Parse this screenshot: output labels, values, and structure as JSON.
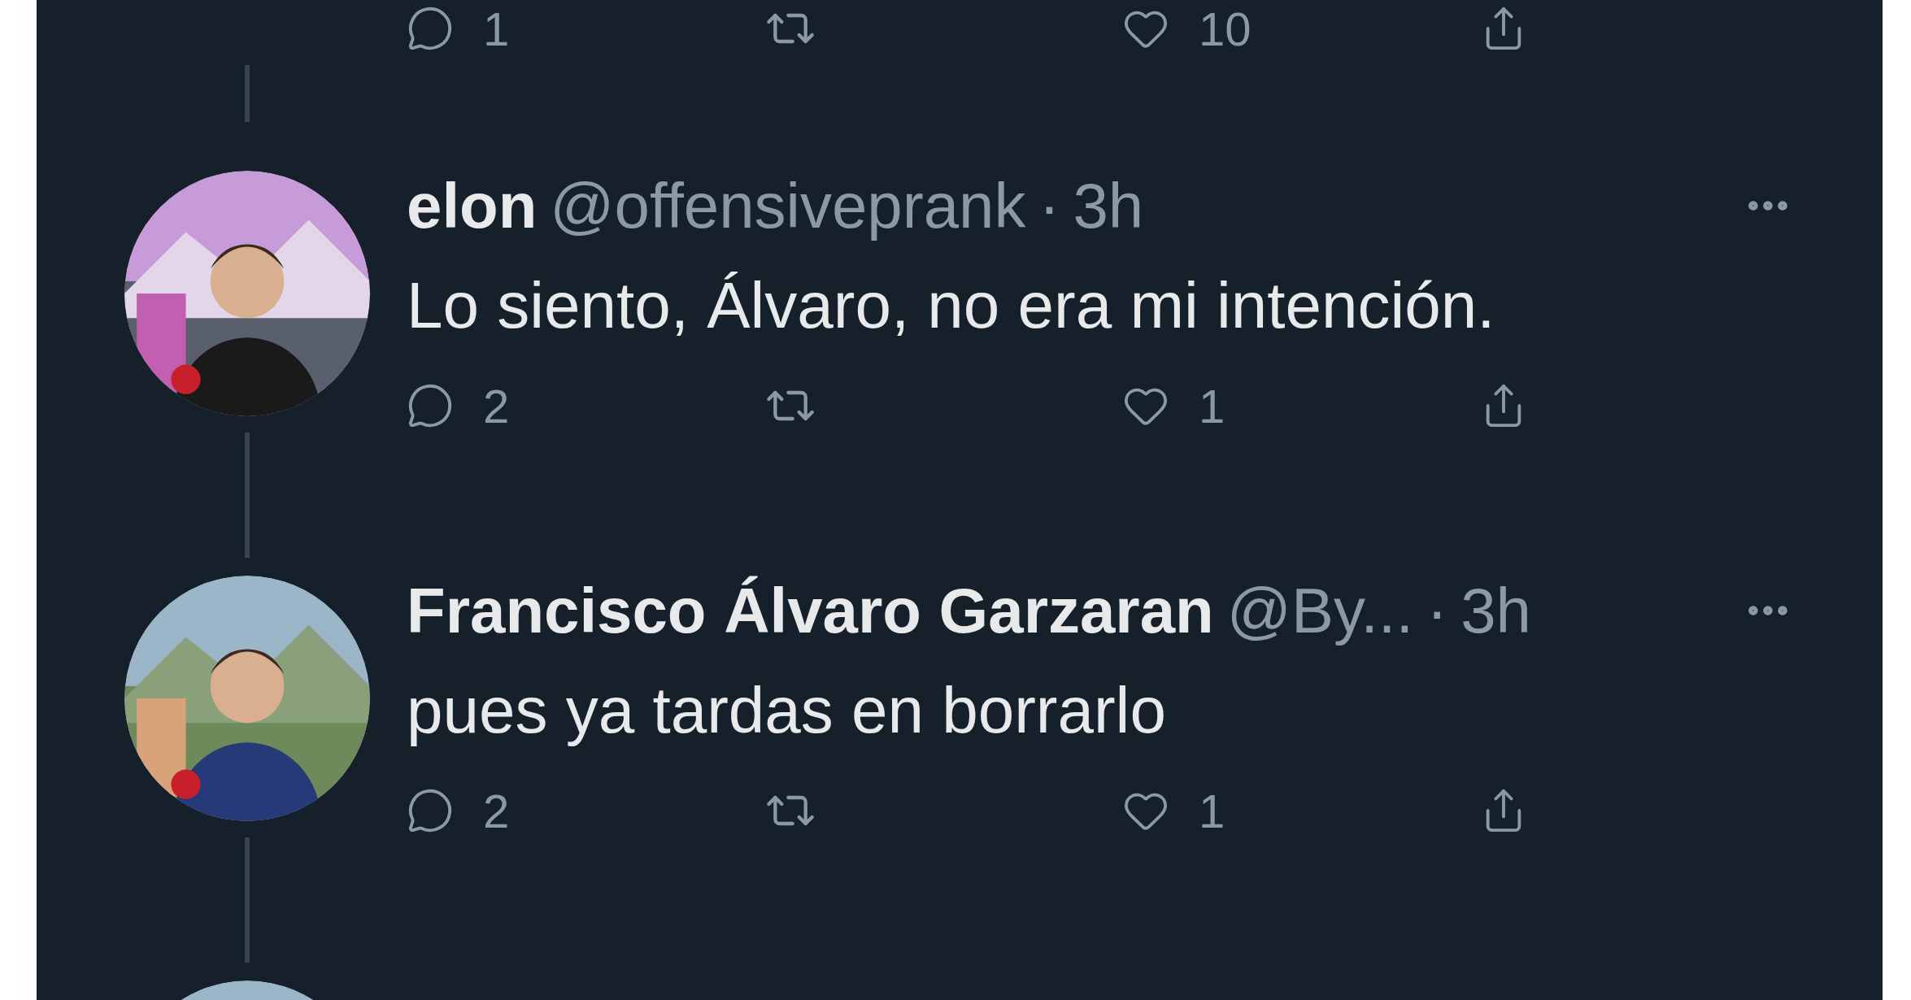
{
  "separator": "·",
  "thread": [
    {
      "kind": "partial",
      "actions": {
        "replies": "1",
        "likes": "10"
      }
    },
    {
      "kind": "tweet",
      "name": "elon",
      "handle": "@offensiveprank",
      "time": "3h",
      "text": "Lo siento, Álvaro, no era mi intención.",
      "actions": {
        "replies": "2",
        "likes": "1"
      }
    },
    {
      "kind": "tweet",
      "name": "Francisco Álvaro Garzaran",
      "handle": "@By...",
      "time": "3h",
      "text": "pues ya tardas en borrarlo",
      "actions": {
        "replies": "2",
        "likes": "1"
      }
    },
    {
      "kind": "avatar_only"
    }
  ]
}
